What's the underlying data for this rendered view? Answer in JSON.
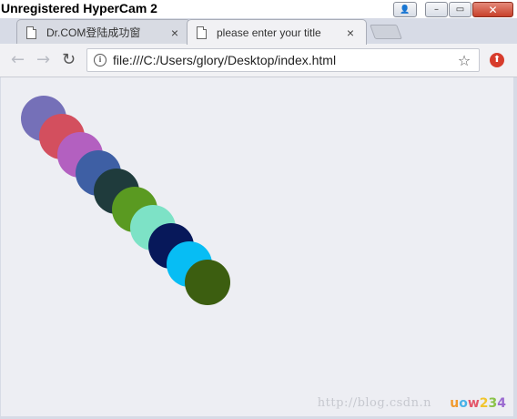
{
  "app": {
    "recorder_title": "Unregistered HyperCam 2",
    "window_controls": {
      "close": "✕",
      "min": "–",
      "max": "▭",
      "user": "👤"
    }
  },
  "tabs": [
    {
      "label": "Dr.COM登陆成功窗",
      "close": "×",
      "active": false
    },
    {
      "label": "please enter your title",
      "close": "×",
      "active": true
    }
  ],
  "toolbar": {
    "back": "←",
    "forward": "→",
    "reload": "↻",
    "url": "file:///C:/Users/glory/Desktop/index.html",
    "info": "i",
    "star": "☆",
    "extension": "⬆"
  },
  "page": {
    "balls": [
      {
        "color": "#7570b8",
        "label": "ball 1"
      },
      {
        "color": "#d34f5e",
        "label": "ball 2"
      },
      {
        "color": "#b360c0",
        "label": "ball 3"
      },
      {
        "color": "#3e5fa4",
        "label": "ball 4"
      },
      {
        "color": "#1f3b3c",
        "label": "ball 5"
      },
      {
        "color": "#5a9a21",
        "label": "ball 6"
      },
      {
        "color": "#7de2c6",
        "label": "ball 7"
      },
      {
        "color": "#07185a",
        "label": "ball 8"
      },
      {
        "color": "#07bdf4",
        "label": "ball 9"
      },
      {
        "color": "#3c5e10",
        "label": "ball 10"
      }
    ],
    "watermark_url": "http://blog.csdn.n",
    "watermark_logo": [
      "u",
      "o",
      "w",
      "2",
      "3",
      "4"
    ],
    "watermark_logo_colors": [
      "#f19a2e",
      "#49b3e8",
      "#e4566a",
      "#f1c52e",
      "#8bc34a",
      "#9b6bd0"
    ]
  }
}
